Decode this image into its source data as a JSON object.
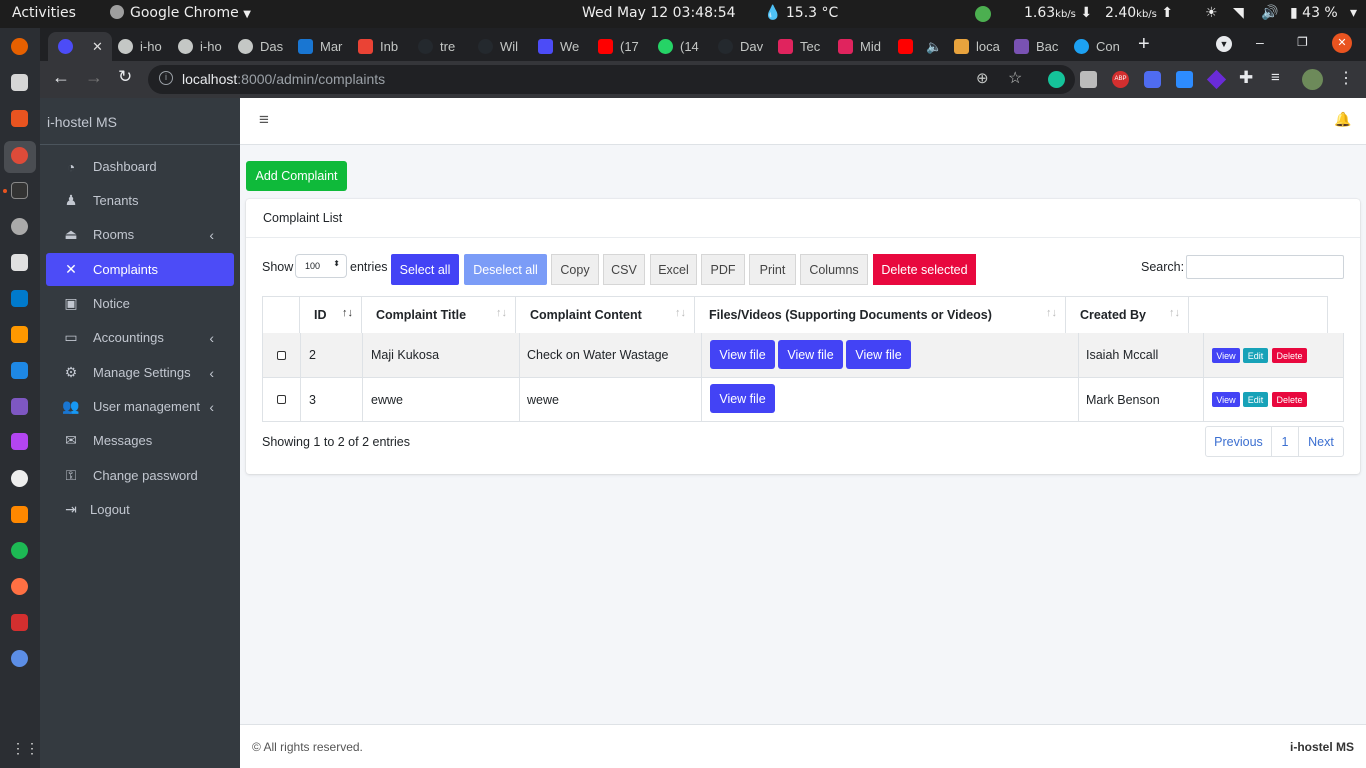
{
  "system": {
    "activities": "Activities",
    "app_name": "Google Chrome",
    "clock": "Wed May 12  03:48:54",
    "weather": "15.3 °C",
    "net_down_value": "1.63",
    "net_down_unit": "kb/s",
    "net_up_value": "2.40",
    "net_up_unit": "kb/s",
    "battery": "43 %"
  },
  "browser": {
    "tabs": [
      "i-ho",
      "i-ho",
      "Das",
      "Mar",
      "Inb",
      "tre",
      "Wil",
      "We",
      "(17",
      "(14",
      "Dav",
      "Tec",
      "Mid",
      "",
      "loca",
      "Bac",
      "Con"
    ],
    "url_host": "localhost",
    "url_path": ":8000/admin/complaints"
  },
  "sidebar": {
    "brand": "i-hostel MS",
    "items": [
      {
        "label": "Dashboard",
        "icon": "tachometer-icon"
      },
      {
        "label": "Tenants",
        "icon": "person-icon"
      },
      {
        "label": "Rooms",
        "icon": "bed-icon"
      },
      {
        "label": "Complaints",
        "icon": "times-icon"
      },
      {
        "label": "Notice",
        "icon": "window-icon"
      },
      {
        "label": "Accountings",
        "icon": "credit-card-icon"
      },
      {
        "label": "Manage Settings",
        "icon": "cogs-icon"
      },
      {
        "label": "User management",
        "icon": "users-icon"
      },
      {
        "label": "Messages",
        "icon": "envelope-icon"
      },
      {
        "label": "Change password",
        "icon": "key-icon"
      },
      {
        "label": "Logout",
        "icon": "sign-out-icon"
      }
    ]
  },
  "page": {
    "add_button": "Add Complaint",
    "card_title": "Complaint List",
    "show_label": "Show",
    "entries_value": "100",
    "entries_label": "entries",
    "buttons": {
      "select_all": "Select all",
      "deselect_all": "Deselect all",
      "copy": "Copy",
      "csv": "CSV",
      "excel": "Excel",
      "pdf": "PDF",
      "print": "Print",
      "columns": "Columns",
      "delete_selected": "Delete selected"
    },
    "search_label": "Search:",
    "columns": [
      "ID",
      "Complaint Title",
      "Complaint Content",
      "Files/Videos (Supporting Documents or Videos)",
      "Created By"
    ],
    "rows": [
      {
        "id": "2",
        "title": "Maji Kukosa",
        "content": "Check on Water Wastage",
        "files": [
          "View file",
          "View file",
          "View file"
        ],
        "created_by": "Isaiah Mccall"
      },
      {
        "id": "3",
        "title": "ewwe",
        "content": "wewe",
        "files": [
          "View file"
        ],
        "created_by": "Mark Benson"
      }
    ],
    "row_actions": {
      "view": "View",
      "edit": "Edit",
      "delete": "Delete"
    },
    "info": "Showing 1 to 2 of 2 entries",
    "pagination": {
      "previous": "Previous",
      "page": "1",
      "next": "Next"
    }
  },
  "footer": {
    "copyright": "© All rights reserved.",
    "brand": "i-hostel MS"
  },
  "colors": {
    "primary": "#4c4cf7",
    "success": "#0fba3a",
    "danger": "#e8083e",
    "info": "#17a2b8",
    "sidebar": "#343a40"
  }
}
